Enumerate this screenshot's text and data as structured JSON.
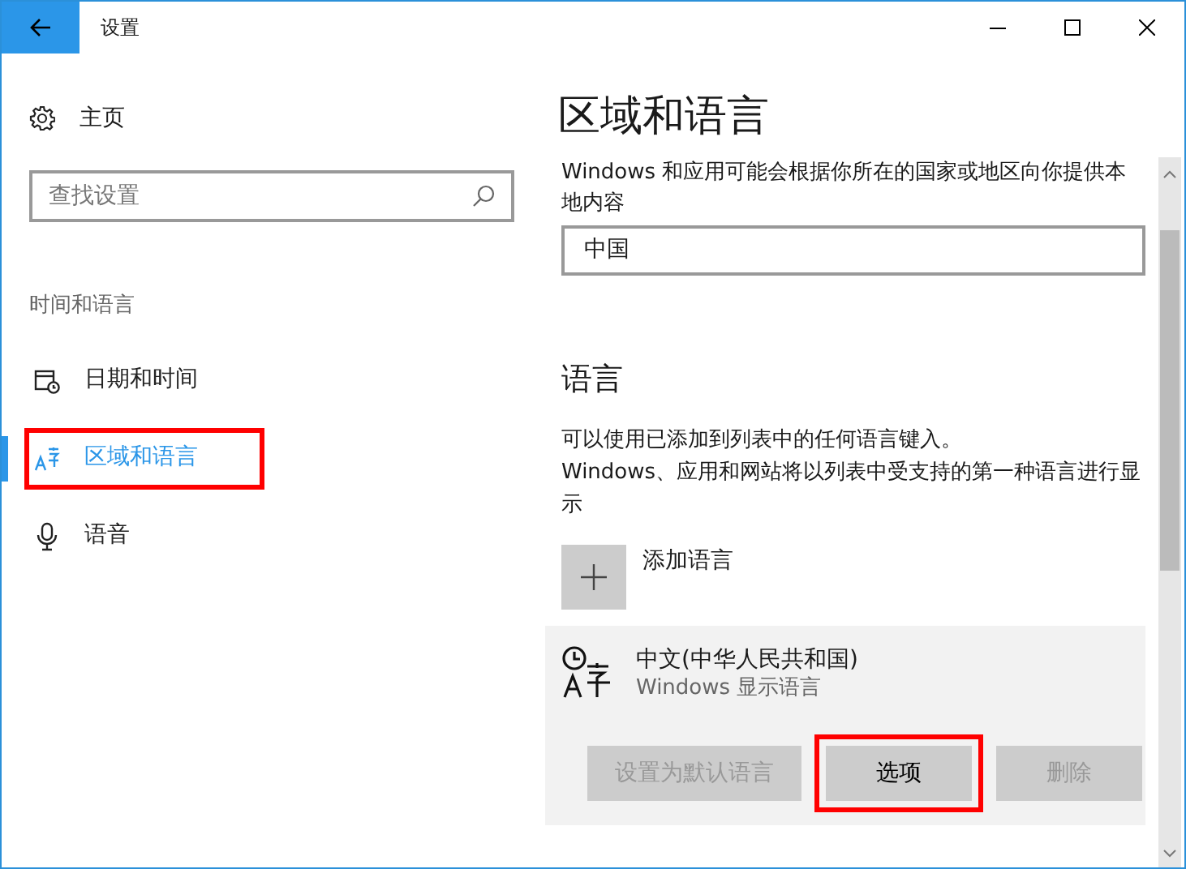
{
  "window": {
    "title": "设置"
  },
  "sidebar": {
    "home": "主页",
    "search": {
      "placeholder": "查找设置"
    },
    "section": "时间和语言",
    "items": [
      {
        "kind": "calendar",
        "label": "日期和时间",
        "selected": false,
        "highlighted": false
      },
      {
        "kind": "language",
        "label": "区域和语言",
        "selected": true,
        "highlighted": true
      },
      {
        "kind": "mic",
        "label": "语音",
        "selected": false,
        "highlighted": false
      }
    ]
  },
  "main": {
    "title": "区域和语言",
    "region_text": "Windows 和应用可能会根据你所在的国家或地区向你提供本地内容",
    "region_value": "中国",
    "language_heading": "语言",
    "language_text": [
      "可以使用已添加到列表中的任何语言键入。",
      "Windows、应用和网站将以列表中受支持的第一种语言进行显示"
    ],
    "add_language": "添加语言",
    "language": {
      "name": "中文(中华人民共和国)",
      "subtitle": "Windows 显示语言",
      "buttons": [
        {
          "label": "设置为默认语言",
          "disabled": true,
          "highlighted": false
        },
        {
          "label": "选项",
          "disabled": false,
          "highlighted": true
        },
        {
          "label": "删除",
          "disabled": true,
          "highlighted": false
        }
      ]
    }
  }
}
